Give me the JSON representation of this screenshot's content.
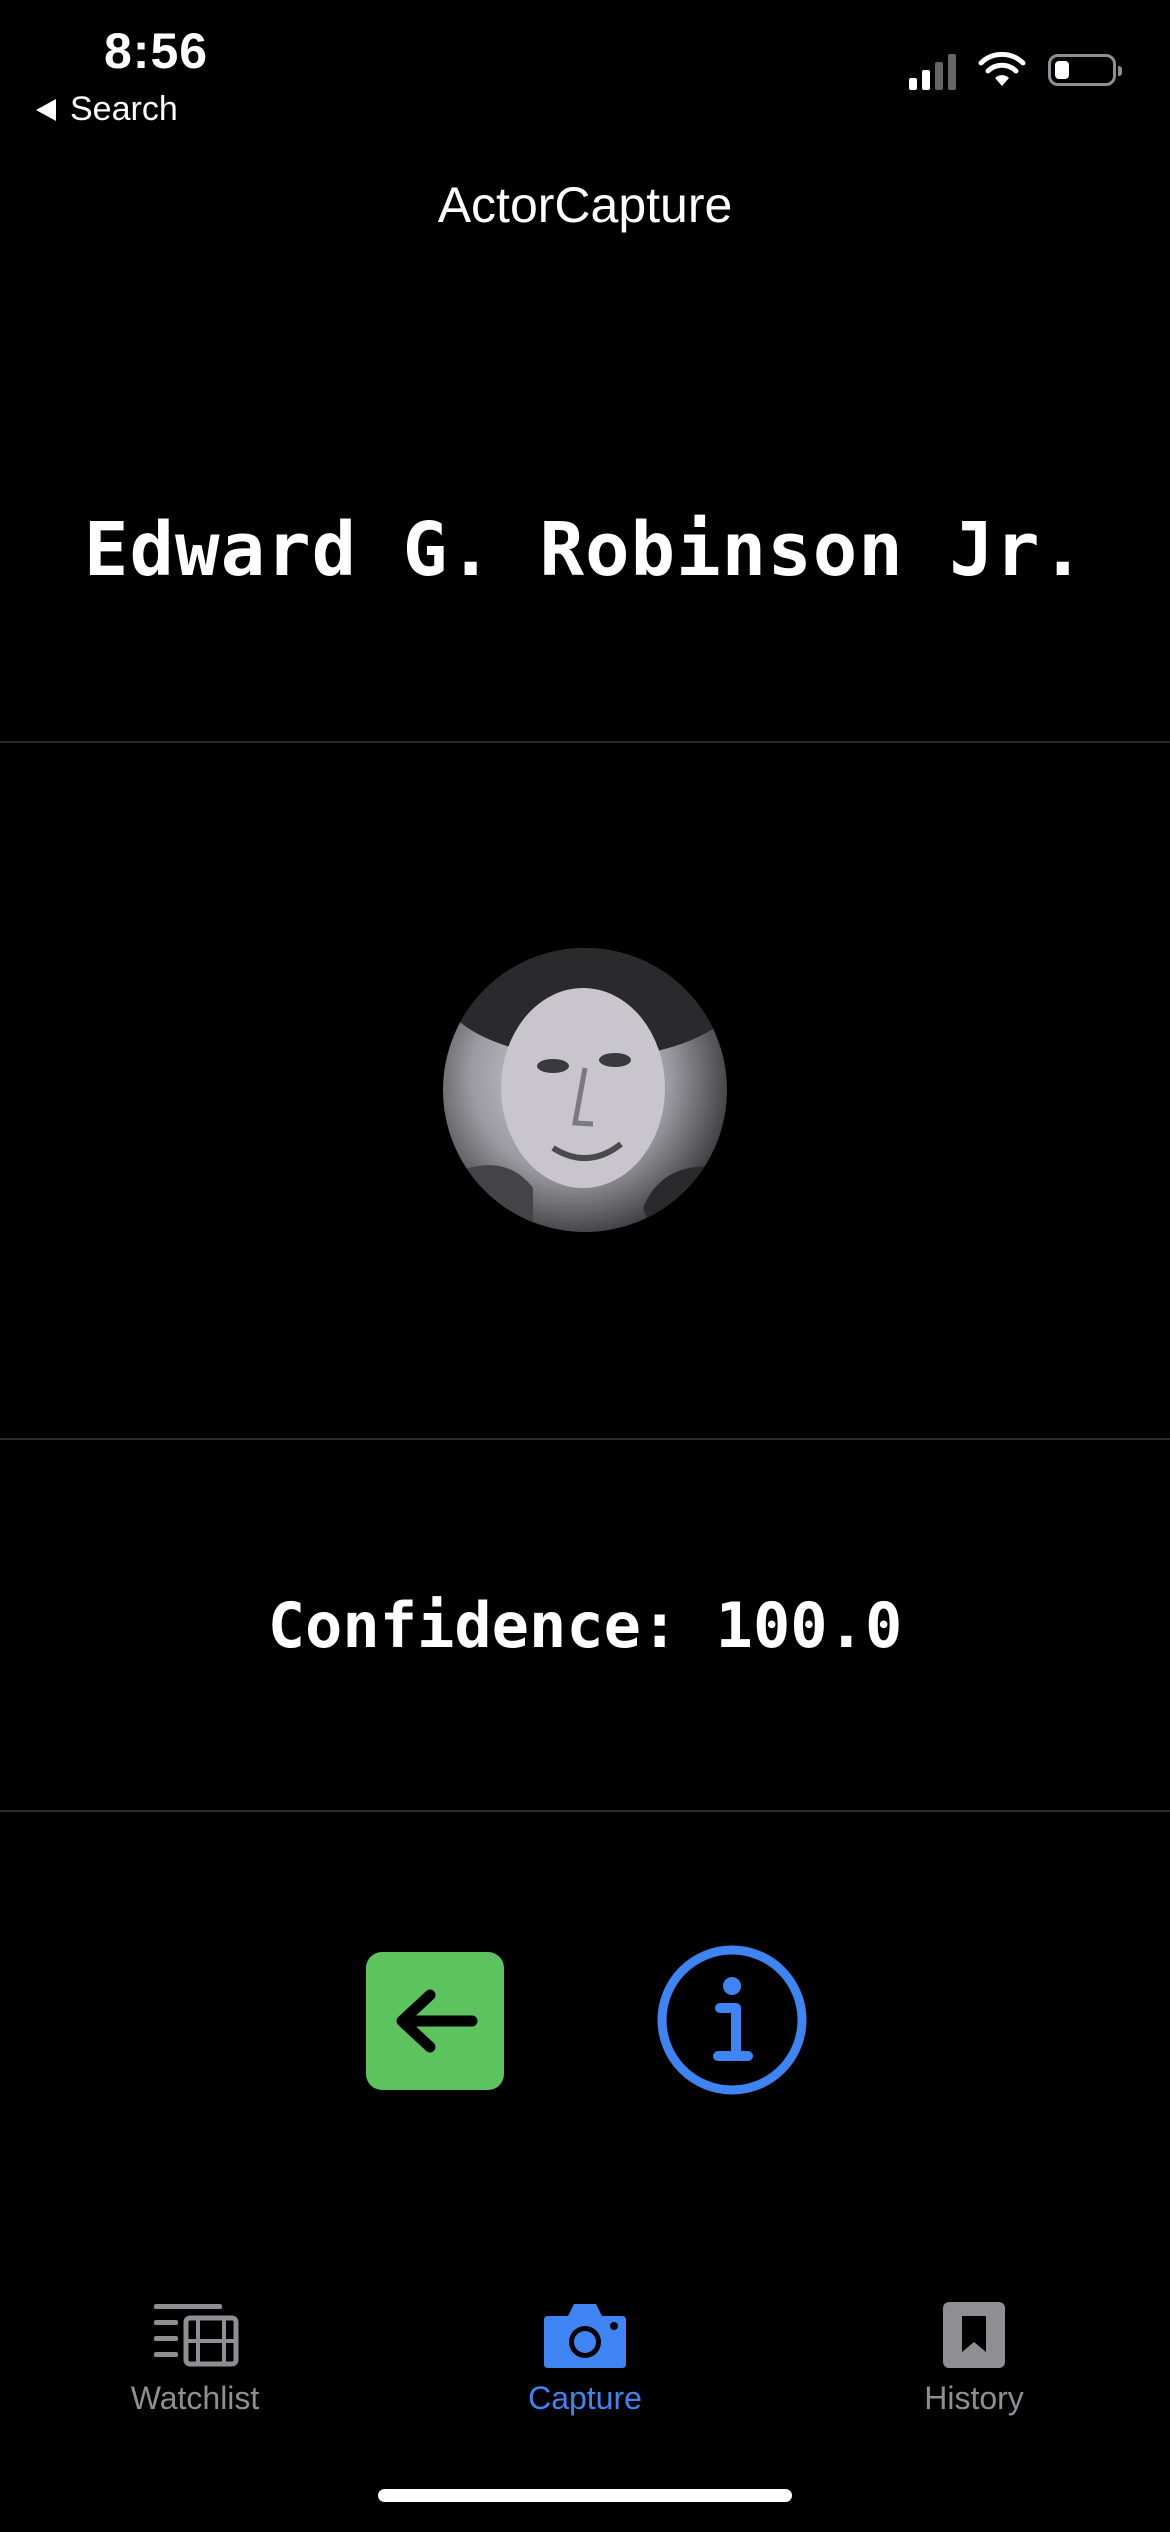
{
  "status_bar": {
    "time": "8:56",
    "back_label": "Search",
    "battery_level": 0.25
  },
  "nav": {
    "title": "ActorCapture"
  },
  "result": {
    "actor_name": "Edward G. Robinson Jr.",
    "confidence_text": "Confidence: 100.0"
  },
  "actions": {
    "back_icon": "arrow-left-icon",
    "info_icon": "info-circle-icon"
  },
  "tabs": [
    {
      "label": "Watchlist",
      "icon": "film-list-icon",
      "active": false
    },
    {
      "label": "Capture",
      "icon": "camera-icon",
      "active": true
    },
    {
      "label": "History",
      "icon": "bookmark-icon",
      "active": false
    }
  ],
  "colors": {
    "accent": "#3f84f3",
    "back_button": "#5dc35f",
    "inactive_tab": "#8e8e93"
  }
}
